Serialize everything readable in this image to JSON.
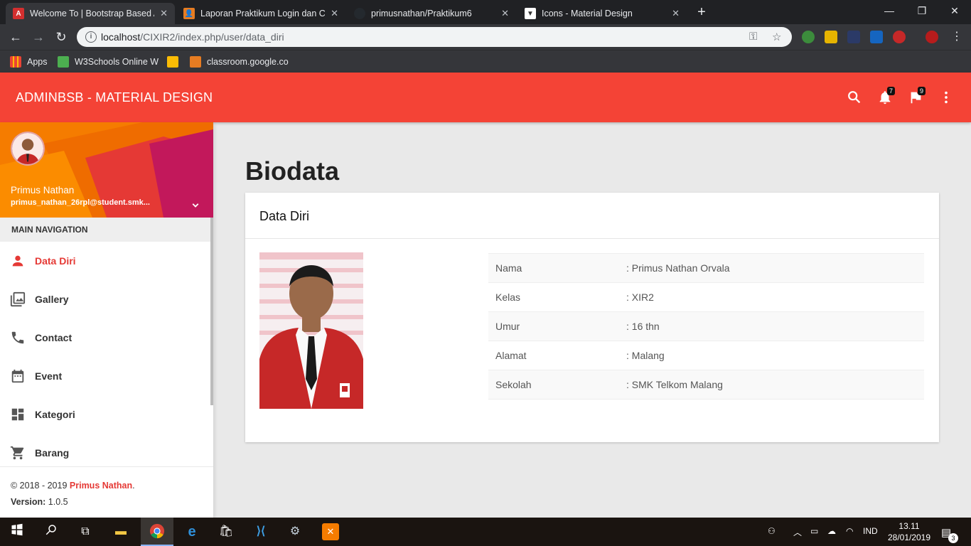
{
  "browser": {
    "tabs": [
      {
        "title": "Welcome To | Bootstrap Based Ad",
        "favicon": "red-a-icon",
        "color": "#d32f2f"
      },
      {
        "title": "Laporan Praktikum Login dan CRU",
        "favicon": "classroom-icon",
        "color": "#e67c22"
      },
      {
        "title": "primusnathan/Praktikum6",
        "favicon": "github-icon",
        "color": "#24292e"
      },
      {
        "title": "Icons - Material Design",
        "favicon": "material-icon",
        "color": "#ffffff"
      }
    ],
    "url_host": "localhost",
    "url_path": "/CIXIR2/index.php/user/data_diri",
    "bookmarks": [
      {
        "label": "Apps",
        "icon": "apps-grid-icon"
      },
      {
        "label": "W3Schools Online W",
        "icon": "w3schools-icon"
      },
      {
        "label": "",
        "icon": "classroom-icon"
      },
      {
        "label": "classroom.google.co",
        "icon": "classroom-icon"
      }
    ]
  },
  "appbar": {
    "brand": "ADMINBSB - MATERIAL DESIGN",
    "notifications_count": "7",
    "tasks_count": "9",
    "color": "#f44336"
  },
  "sidebar": {
    "user_name": "Primus Nathan",
    "user_email": "primus_nathan_26rpl@student.smk...",
    "menu_header": "MAIN NAVIGATION",
    "items": [
      {
        "label": "Data Diri",
        "icon": "person-icon",
        "active": true
      },
      {
        "label": "Gallery",
        "icon": "photo-library-icon",
        "active": false
      },
      {
        "label": "Contact",
        "icon": "phone-icon",
        "active": false
      },
      {
        "label": "Event",
        "icon": "calendar-icon",
        "active": false
      },
      {
        "label": "Kategori",
        "icon": "dashboard-icon",
        "active": false
      },
      {
        "label": "Barang",
        "icon": "cart-icon",
        "active": false
      }
    ],
    "footer": {
      "copyright_prefix": "© 2018 - 2019 ",
      "copyright_name": "Primus Nathan",
      "copyright_suffix": ".",
      "version_label": "Version:",
      "version_value": " 1.0.5"
    }
  },
  "page": {
    "title": "Biodata",
    "card_title": "Data Diri",
    "rows": [
      {
        "key": "Nama",
        "value": ": Primus Nathan Orvala"
      },
      {
        "key": "Kelas",
        "value": ": XIR2"
      },
      {
        "key": "Umur",
        "value": ": 16 thn"
      },
      {
        "key": "Alamat",
        "value": ": Malang"
      },
      {
        "key": "Sekolah",
        "value": ": SMK Telkom Malang"
      }
    ]
  },
  "taskbar": {
    "time": "13.11",
    "date": "28/01/2019",
    "lang": "IND",
    "notif_count": "3"
  }
}
